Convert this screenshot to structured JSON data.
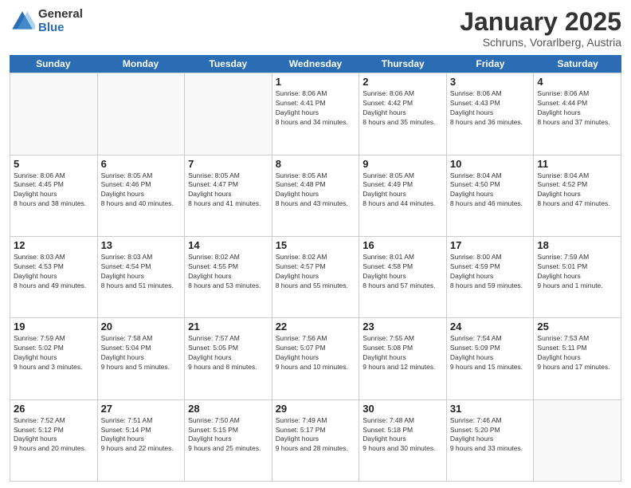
{
  "logo": {
    "general": "General",
    "blue": "Blue"
  },
  "title": "January 2025",
  "subtitle": "Schruns, Vorarlberg, Austria",
  "weekdays": [
    "Sunday",
    "Monday",
    "Tuesday",
    "Wednesday",
    "Thursday",
    "Friday",
    "Saturday"
  ],
  "weeks": [
    [
      {
        "day": "",
        "empty": true
      },
      {
        "day": "",
        "empty": true
      },
      {
        "day": "",
        "empty": true
      },
      {
        "day": "1",
        "sunrise": "8:06 AM",
        "sunset": "4:41 PM",
        "daylight": "8 hours and 34 minutes."
      },
      {
        "day": "2",
        "sunrise": "8:06 AM",
        "sunset": "4:42 PM",
        "daylight": "8 hours and 35 minutes."
      },
      {
        "day": "3",
        "sunrise": "8:06 AM",
        "sunset": "4:43 PM",
        "daylight": "8 hours and 36 minutes."
      },
      {
        "day": "4",
        "sunrise": "8:06 AM",
        "sunset": "4:44 PM",
        "daylight": "8 hours and 37 minutes."
      }
    ],
    [
      {
        "day": "5",
        "sunrise": "8:06 AM",
        "sunset": "4:45 PM",
        "daylight": "8 hours and 38 minutes."
      },
      {
        "day": "6",
        "sunrise": "8:05 AM",
        "sunset": "4:46 PM",
        "daylight": "8 hours and 40 minutes."
      },
      {
        "day": "7",
        "sunrise": "8:05 AM",
        "sunset": "4:47 PM",
        "daylight": "8 hours and 41 minutes."
      },
      {
        "day": "8",
        "sunrise": "8:05 AM",
        "sunset": "4:48 PM",
        "daylight": "8 hours and 43 minutes."
      },
      {
        "day": "9",
        "sunrise": "8:05 AM",
        "sunset": "4:49 PM",
        "daylight": "8 hours and 44 minutes."
      },
      {
        "day": "10",
        "sunrise": "8:04 AM",
        "sunset": "4:50 PM",
        "daylight": "8 hours and 46 minutes."
      },
      {
        "day": "11",
        "sunrise": "8:04 AM",
        "sunset": "4:52 PM",
        "daylight": "8 hours and 47 minutes."
      }
    ],
    [
      {
        "day": "12",
        "sunrise": "8:03 AM",
        "sunset": "4:53 PM",
        "daylight": "8 hours and 49 minutes."
      },
      {
        "day": "13",
        "sunrise": "8:03 AM",
        "sunset": "4:54 PM",
        "daylight": "8 hours and 51 minutes."
      },
      {
        "day": "14",
        "sunrise": "8:02 AM",
        "sunset": "4:55 PM",
        "daylight": "8 hours and 53 minutes."
      },
      {
        "day": "15",
        "sunrise": "8:02 AM",
        "sunset": "4:57 PM",
        "daylight": "8 hours and 55 minutes."
      },
      {
        "day": "16",
        "sunrise": "8:01 AM",
        "sunset": "4:58 PM",
        "daylight": "8 hours and 57 minutes."
      },
      {
        "day": "17",
        "sunrise": "8:00 AM",
        "sunset": "4:59 PM",
        "daylight": "8 hours and 59 minutes."
      },
      {
        "day": "18",
        "sunrise": "7:59 AM",
        "sunset": "5:01 PM",
        "daylight": "9 hours and 1 minute."
      }
    ],
    [
      {
        "day": "19",
        "sunrise": "7:59 AM",
        "sunset": "5:02 PM",
        "daylight": "9 hours and 3 minutes."
      },
      {
        "day": "20",
        "sunrise": "7:58 AM",
        "sunset": "5:04 PM",
        "daylight": "9 hours and 5 minutes."
      },
      {
        "day": "21",
        "sunrise": "7:57 AM",
        "sunset": "5:05 PM",
        "daylight": "9 hours and 8 minutes."
      },
      {
        "day": "22",
        "sunrise": "7:56 AM",
        "sunset": "5:07 PM",
        "daylight": "9 hours and 10 minutes."
      },
      {
        "day": "23",
        "sunrise": "7:55 AM",
        "sunset": "5:08 PM",
        "daylight": "9 hours and 12 minutes."
      },
      {
        "day": "24",
        "sunrise": "7:54 AM",
        "sunset": "5:09 PM",
        "daylight": "9 hours and 15 minutes."
      },
      {
        "day": "25",
        "sunrise": "7:53 AM",
        "sunset": "5:11 PM",
        "daylight": "9 hours and 17 minutes."
      }
    ],
    [
      {
        "day": "26",
        "sunrise": "7:52 AM",
        "sunset": "5:12 PM",
        "daylight": "9 hours and 20 minutes."
      },
      {
        "day": "27",
        "sunrise": "7:51 AM",
        "sunset": "5:14 PM",
        "daylight": "9 hours and 22 minutes."
      },
      {
        "day": "28",
        "sunrise": "7:50 AM",
        "sunset": "5:15 PM",
        "daylight": "9 hours and 25 minutes."
      },
      {
        "day": "29",
        "sunrise": "7:49 AM",
        "sunset": "5:17 PM",
        "daylight": "9 hours and 28 minutes."
      },
      {
        "day": "30",
        "sunrise": "7:48 AM",
        "sunset": "5:18 PM",
        "daylight": "9 hours and 30 minutes."
      },
      {
        "day": "31",
        "sunrise": "7:46 AM",
        "sunset": "5:20 PM",
        "daylight": "9 hours and 33 minutes."
      },
      {
        "day": "",
        "empty": true
      }
    ]
  ]
}
